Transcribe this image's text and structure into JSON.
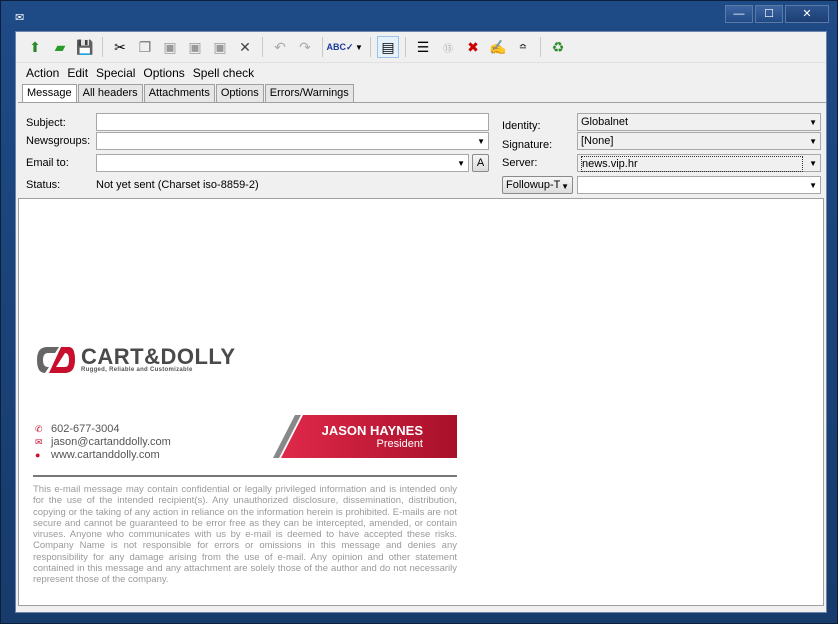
{
  "window": {
    "minimize": "—",
    "maximize": "☐",
    "close": "✕"
  },
  "toolbar": {
    "icons": [
      "send-icon",
      "send-later-icon",
      "save-icon",
      "cut-icon",
      "copy-icon",
      "paste-icon",
      "paste-quote-icon",
      "paste-special-icon",
      "delete-icon",
      "undo-icon",
      "redo-icon",
      "spell-check-icon",
      "view-icon",
      "headers-icon",
      "rot13-icon",
      "remove-icon",
      "sign-icon",
      "wrap-icon",
      "recycle-icon"
    ]
  },
  "menu": [
    "Action",
    "Edit",
    "Special",
    "Options",
    "Spell check"
  ],
  "tabs": [
    "Message",
    "All headers",
    "Attachments",
    "Options",
    "Errors/Warnings"
  ],
  "form": {
    "subject_label": "Subject:",
    "subject_value": "",
    "newsgroups_label": "Newsgroups:",
    "newsgroups_value": "",
    "email_label": "Email to:",
    "email_value": "",
    "address_button": "A",
    "status_label": "Status:",
    "status_value": "Not yet sent (Charset iso-8859-2)",
    "identity_label": "Identity:",
    "identity_value": "Globalnet",
    "signature_label": "Signature:",
    "signature_value": "[None]",
    "server_label": "Server:",
    "server_value": "news.vip.hr",
    "followup_button": "Followup-T",
    "followup_value": ""
  },
  "signature": {
    "brand": "CART&DOLLY",
    "tagline": "Rugged, Reliable and Customizable",
    "phone": "602-677-3004",
    "email": "jason@cartanddolly.com",
    "web": "www.cartanddolly.com",
    "name": "JASON HAYNES",
    "title": "President",
    "accent": "#c8102e",
    "disclaimer": "This e-mail message may contain confidential or legally privileged information and is intended only for the use of the intended recipient(s). Any unauthorized disclosure, dissemination, distribution, copying or the taking of any action in reliance on the information herein is prohibited. E-mails are not secure and cannot be guaranteed to be error free as they can be intercepted, amended, or contain viruses. Anyone who communicates with us by e-mail is deemed to have accepted these risks. Company Name is not responsible for errors or omissions in this message and denies any responsibility for any damage arising from the use of e-mail. Any opinion and other statement contained in this message and any attachment are solely those of the author and do not necessarily represent those of the company."
  }
}
